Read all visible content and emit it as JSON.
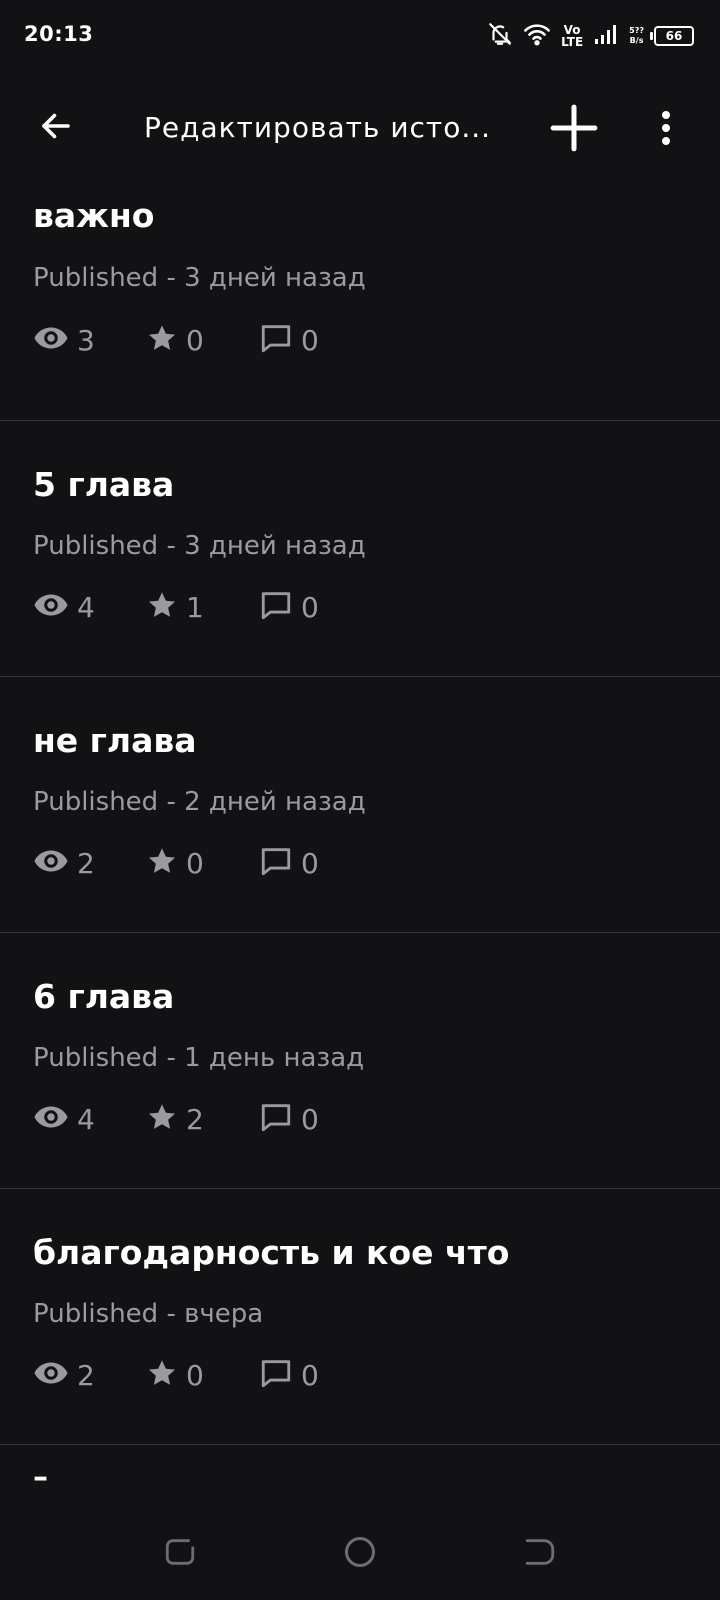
{
  "status": {
    "time": "20:13",
    "network_top": "Vo",
    "network_bottom": "LTE",
    "speed_top": "5??",
    "speed_bottom": "B/s",
    "battery": "66"
  },
  "app_bar": {
    "title": "Редактировать исто..."
  },
  "parts": [
    {
      "title": "важно",
      "meta": "Published - 3 дней назад",
      "views": "3",
      "votes": "0",
      "comments": "0"
    },
    {
      "title": "5 глава",
      "meta": "Published - 3 дней назад",
      "views": "4",
      "votes": "1",
      "comments": "0"
    },
    {
      "title": "не глава",
      "meta": "Published - 2 дней назад",
      "views": "2",
      "votes": "0",
      "comments": "0"
    },
    {
      "title": "6 глава",
      "meta": "Published - 1 день назад",
      "views": "4",
      "votes": "2",
      "comments": "0"
    },
    {
      "title": "благодарность и кое что",
      "meta": "Published - вчера",
      "views": "2",
      "votes": "0",
      "comments": "0"
    }
  ],
  "partial_item_title": "–",
  "colors": {
    "background": "#121114",
    "text": "#ffffff",
    "secondary": "#9c9a9f",
    "divider": "#38363b"
  }
}
